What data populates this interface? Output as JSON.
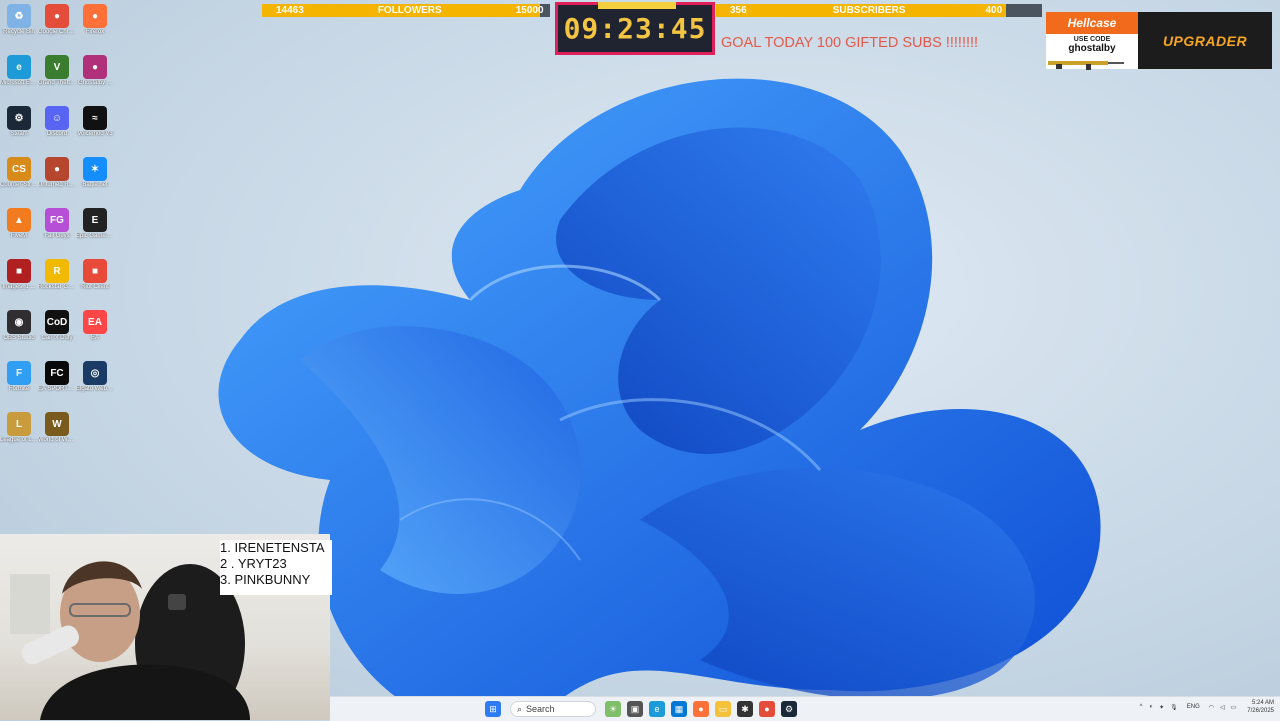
{
  "desktop": {
    "icons": [
      {
        "label": "Recycle Bin",
        "color": "#7fb2e5",
        "glyph": "♻"
      },
      {
        "label": "Google Chrome",
        "color": "#e44d3a",
        "glyph": "●"
      },
      {
        "label": "Firefox",
        "color": "#ff7139",
        "glyph": "●"
      },
      {
        "label": "Microsoft Edge",
        "color": "#1c9bd8",
        "glyph": "e"
      },
      {
        "label": "Grand Theft Auto V",
        "color": "#3a7d2e",
        "glyph": "V"
      },
      {
        "label": "Ghostalby ...",
        "color": "#b0307a",
        "glyph": "●"
      },
      {
        "label": "Steam",
        "color": "#1b2838",
        "glyph": "⚙"
      },
      {
        "label": "Discord",
        "color": "#5865f2",
        "glyph": "☺"
      },
      {
        "label": "Voicemod V3",
        "color": "#111111",
        "glyph": "≈"
      },
      {
        "label": "Counter-Strike 2",
        "color": "#d98b1a",
        "glyph": "CS"
      },
      {
        "label": "Unturned Respawn",
        "color": "#b7462e",
        "glyph": "●"
      },
      {
        "label": "Battle.net",
        "color": "#148eff",
        "glyph": "✶"
      },
      {
        "label": "FiveM",
        "color": "#f27b1f",
        "glyph": "▲"
      },
      {
        "label": "Fall Guys",
        "color": "#b64fd6",
        "glyph": "FG"
      },
      {
        "label": "Epic Games Launcher",
        "color": "#222222",
        "glyph": "E"
      },
      {
        "label": "Images_1 ...",
        "color": "#b02020",
        "glyph": "■"
      },
      {
        "label": "Rockstar Games",
        "color": "#f1b900",
        "glyph": "R"
      },
      {
        "label": "Riot Client",
        "color": "#e84a3a",
        "glyph": "■"
      },
      {
        "label": "OBS Studio",
        "color": "#302e31",
        "glyph": "◉"
      },
      {
        "label": "Call of Duty",
        "color": "#111111",
        "glyph": "CoD"
      },
      {
        "label": "EA",
        "color": "#ff4747",
        "glyph": "EA"
      },
      {
        "label": "Fortnite",
        "color": "#2f9ef3",
        "glyph": "F"
      },
      {
        "label": "EA SPORTS FC 25",
        "color": "#0a0a0a",
        "glyph": "FC"
      },
      {
        "label": "Elgato Webcam",
        "color": "#1a3b66",
        "glyph": "◎"
      },
      {
        "label": "League of Legends",
        "color": "#c89b3c",
        "glyph": "L"
      },
      {
        "label": "World of Warcraft",
        "color": "#7b5a1e",
        "glyph": "W"
      }
    ]
  },
  "overlay": {
    "followers": {
      "current": "14463",
      "label": "FOLLOWERS",
      "goal": "15000",
      "progress": 0.964
    },
    "subscribers": {
      "current": "356",
      "label": "SUBSCRIBERS",
      "goal": "400",
      "progress": 0.89
    },
    "timer": "09:23:45",
    "goal_text": "GOAL TODAY 100 GIFTED SUBS !!!!!!!!",
    "promo": {
      "brand": "Hellcase",
      "use_code_label": "USE CODE",
      "code": "ghostalby",
      "cta": "UPGRADER"
    },
    "top_list": [
      "1. IRENETENSTA",
      "2 . YRYT23",
      "3. PINKBUNNY"
    ]
  },
  "taskbar": {
    "search_placeholder": "Search",
    "language": "ENG",
    "time": "5:24 AM",
    "date": "7/26/2025"
  },
  "colors": {
    "accent_yellow": "#f4b400",
    "timer_border": "#e01f5b",
    "goal_red": "#e35a4a",
    "hellcase_orange": "#f26b1d"
  }
}
